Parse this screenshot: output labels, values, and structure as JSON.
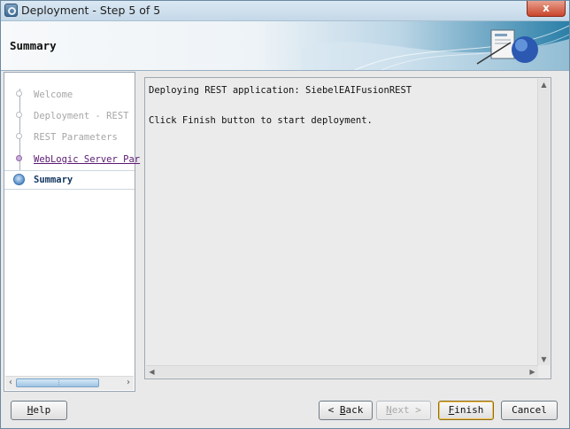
{
  "window": {
    "title": "Deployment - Step 5 of 5",
    "close_label": "x"
  },
  "banner": {
    "title": "Summary"
  },
  "nav": {
    "items": [
      {
        "label": "Welcome",
        "state": "disabled"
      },
      {
        "label": "Deployment - REST",
        "state": "disabled"
      },
      {
        "label": "REST Parameters",
        "state": "disabled"
      },
      {
        "label": "WebLogic Server Par",
        "state": "visited"
      },
      {
        "label": "Summary",
        "state": "current"
      }
    ]
  },
  "content": {
    "line1": "Deploying REST application: SiebelEAIFusionREST",
    "line2": "Click Finish button to start deployment."
  },
  "buttons": {
    "help": {
      "mnemonic": "H",
      "rest": "elp"
    },
    "back": {
      "arrow": "<",
      "mnemonic": "B",
      "rest": "ack"
    },
    "next": {
      "mnemonic": "N",
      "rest": "ext",
      "arrow": ">"
    },
    "finish": {
      "mnemonic": "F",
      "rest": "inish"
    },
    "cancel": {
      "label": "Cancel"
    }
  },
  "colors": {
    "accent": "#2a7fa8",
    "visited_link": "#5b1a72",
    "close": "#c9452d"
  }
}
